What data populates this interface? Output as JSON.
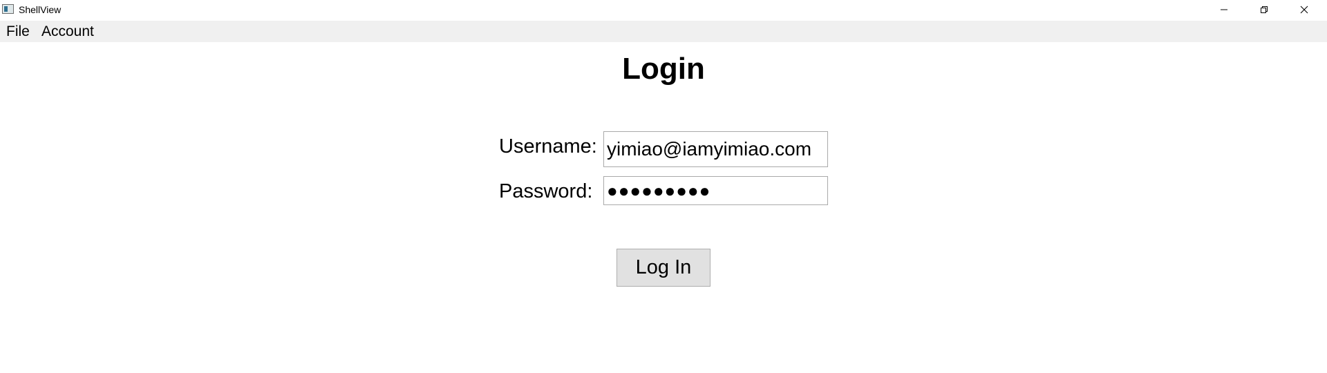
{
  "window": {
    "title": "ShellView",
    "controls": {
      "minimize": "minimize-icon",
      "maximize": "restore-icon",
      "close": "close-icon"
    }
  },
  "menubar": {
    "items": [
      {
        "label": "File"
      },
      {
        "label": "Account"
      }
    ]
  },
  "login": {
    "heading": "Login",
    "username_label": "Username:",
    "username_value": "yimiao@iamyimiao.com",
    "password_label": "Password:",
    "password_value": "●●●●●●●●●",
    "submit_label": "Log In"
  },
  "colors": {
    "menubar_bg": "#f0f0f0",
    "button_bg": "#e1e1e1",
    "field_border": "#a9a9a9"
  }
}
